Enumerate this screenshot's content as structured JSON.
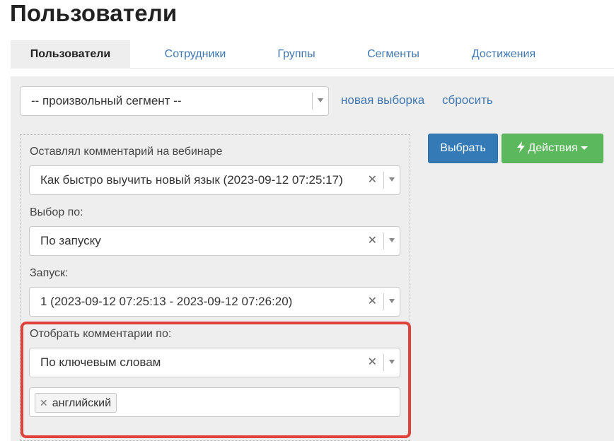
{
  "page": {
    "title": "Пользователи"
  },
  "tabs": [
    {
      "label": "Пользователи",
      "active": true
    },
    {
      "label": "Сотрудники"
    },
    {
      "label": "Группы"
    },
    {
      "label": "Сегменты"
    },
    {
      "label": "Достижения"
    }
  ],
  "segment": {
    "select_value": "-- произвольный сегмент --",
    "new_selection_link": "новая выборка",
    "reset_link": "сбросить"
  },
  "filters": {
    "webinar_label": "Оставлял комментарий на вебинаре",
    "webinar_value": "Как быстро выучить новый язык (2023-09-12 07:25:17)",
    "choose_by_label": "Выбор по:",
    "choose_by_value": "По запуску",
    "launch_label": "Запуск:",
    "launch_value": "1 (2023-09-12 07:25:13 - 2023-09-12 07:26:20)",
    "comments_by_label": "Отобрать комментарии по:",
    "comments_by_value": "По ключевым словам",
    "keywords": [
      "английский"
    ]
  },
  "actions": {
    "select_button": "Выбрать",
    "actions_button": "Действия"
  },
  "colors": {
    "link": "#3f77b0",
    "primary": "#337ab7",
    "success": "#5cb85c",
    "highlight": "#e0413a"
  },
  "icons": {
    "clear": "close-icon",
    "dropdown": "chevron-down-icon",
    "actions": "lightning-icon"
  }
}
